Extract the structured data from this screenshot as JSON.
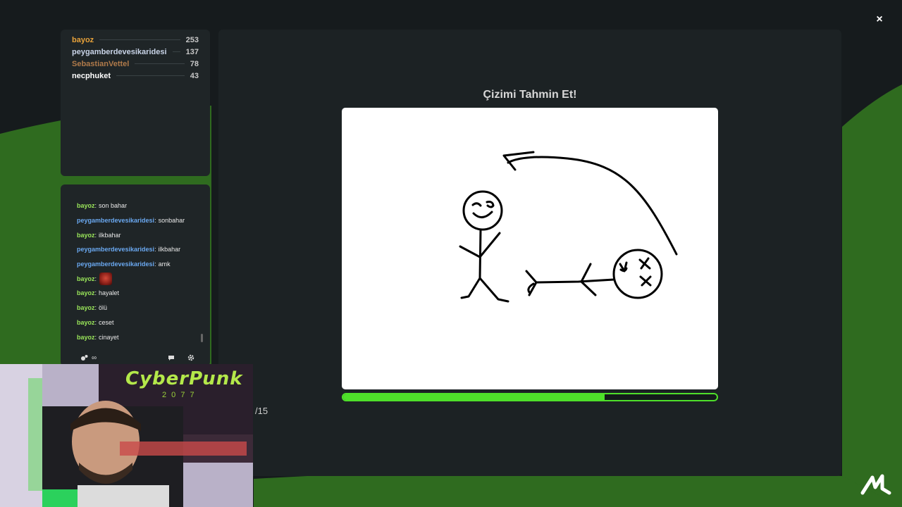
{
  "leaderboard": [
    {
      "name": "bayoz",
      "score": "253",
      "color": "#e8a23a"
    },
    {
      "name": "peygamberdevesikaridesi",
      "score": "137",
      "color": "#c9d4e8"
    },
    {
      "name": "SebastianVettel",
      "score": "78",
      "color": "#b07a4a"
    },
    {
      "name": "necphuket",
      "score": "43",
      "color": "#ffffff"
    }
  ],
  "chat": {
    "messages": [
      {
        "user": "bayoz",
        "text": "son bahar",
        "user_color": "#9ae65a"
      },
      {
        "user": "peygamberdevesikaridesi",
        "text": "sonbahar",
        "user_color": "#6aa8f0"
      },
      {
        "user": "bayoz",
        "text": "ilkbahar",
        "user_color": "#9ae65a"
      },
      {
        "user": "peygamberdevesikaridesi",
        "text": "ilkbahar",
        "user_color": "#6aa8f0"
      },
      {
        "user": "peygamberdevesikaridesi",
        "text": "amk",
        "user_color": "#6aa8f0"
      },
      {
        "user": "bayoz",
        "text": "",
        "emote": "devil-emote",
        "user_color": "#9ae65a"
      },
      {
        "user": "bayoz",
        "text": "hayalet",
        "user_color": "#9ae65a"
      },
      {
        "user": "bayoz",
        "text": "ölü",
        "user_color": "#9ae65a"
      },
      {
        "user": "bayoz",
        "text": "ceset",
        "user_color": "#9ae65a"
      },
      {
        "user": "bayoz",
        "text": "cinayet",
        "user_color": "#9ae65a"
      }
    ],
    "footer_count": "∞",
    "icons": [
      "users-icon",
      "chat-bubble-icon",
      "gear-icon"
    ]
  },
  "game": {
    "title": "Çizimi Tahmin Et!",
    "progress": 0.7,
    "round_counter": "/15"
  },
  "webcam": {
    "overlay_text": "CyberPunk",
    "overlay_sub": "2 0 7 7"
  },
  "colors": {
    "accent": "#4ee02a",
    "panel": "#1f2527",
    "background": "#161b1d",
    "bg_green": "#2f6b1f"
  },
  "close_label": "×"
}
